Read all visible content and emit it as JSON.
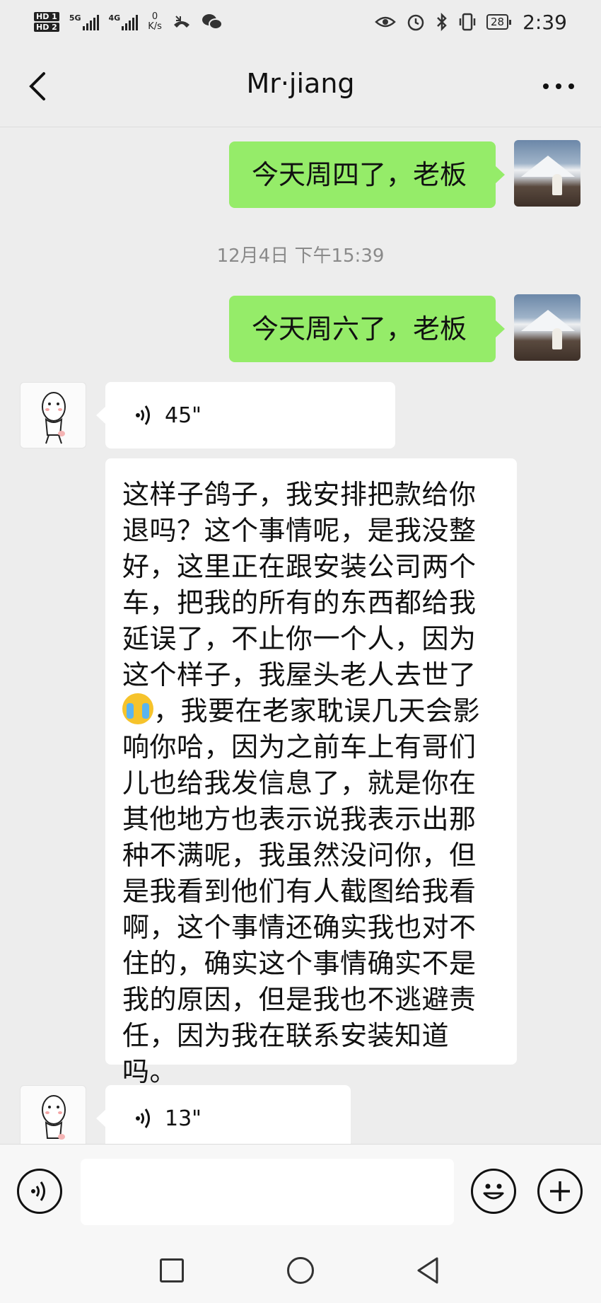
{
  "status_bar": {
    "hd1": "HD 1",
    "hd2": "HD 2",
    "net1": "5G",
    "net2": "4G",
    "speed_value": "0",
    "speed_unit": "K/s",
    "battery": "28",
    "time": "2:39",
    "icons": [
      "eye-icon",
      "alarm-icon",
      "bluetooth-icon",
      "vibrate-icon",
      "battery-icon",
      "missed-call-icon",
      "wechat-icon"
    ]
  },
  "header": {
    "title": "Mr·jiang",
    "back_icon": "chevron-left-icon",
    "more_icon": "more-dots-icon"
  },
  "messages": [
    {
      "side": "me",
      "type": "text",
      "text": "今天周四了，老板"
    },
    {
      "type": "timestamp",
      "text": "12月4日 下午15:39"
    },
    {
      "side": "me",
      "type": "text",
      "text": "今天周六了，老板"
    },
    {
      "side": "other",
      "type": "voice",
      "duration": "45\""
    },
    {
      "side": "other",
      "type": "text",
      "lines": [
        "这样子鸽子，我安排把款给你",
        "退吗？这个事情呢，是我没整",
        "好，这里正在跟安装公司两个",
        "车，把我的所有的东西都给我",
        "延误了，不止你一个人，因为",
        "这个样子，我屋头老人去世了",
        "，我要在老家耽误几天会影",
        "响你哈，因为之前车上有哥们",
        "儿也给我发信息了，就是你在",
        "其他地方也表示说我表示出那",
        "种不满呢，我虽然没问你，但",
        "是我看到他们有人截图给我看",
        "啊，这个事情还确实我也对不",
        "住的，确实这个事情确实不是",
        "我的原因，但是我也不逃避责",
        "任，因为我在联系安装知道吗。"
      ],
      "emoji": "crying-emoji-icon"
    },
    {
      "side": "other",
      "type": "voice",
      "duration": "13\""
    }
  ],
  "input_bar": {
    "voice_button_icon": "voice-input-icon",
    "text_value": "",
    "emoji_button_icon": "smiley-icon",
    "plus_button_icon": "plus-icon"
  },
  "system_nav": {
    "recents_icon": "square-icon",
    "home_icon": "circle-icon",
    "back_icon": "triangle-back-icon"
  },
  "colors": {
    "background": "#ededed",
    "my_bubble": "#95ec69",
    "other_bubble": "#ffffff",
    "timestamp_text": "#8a8a8a"
  }
}
